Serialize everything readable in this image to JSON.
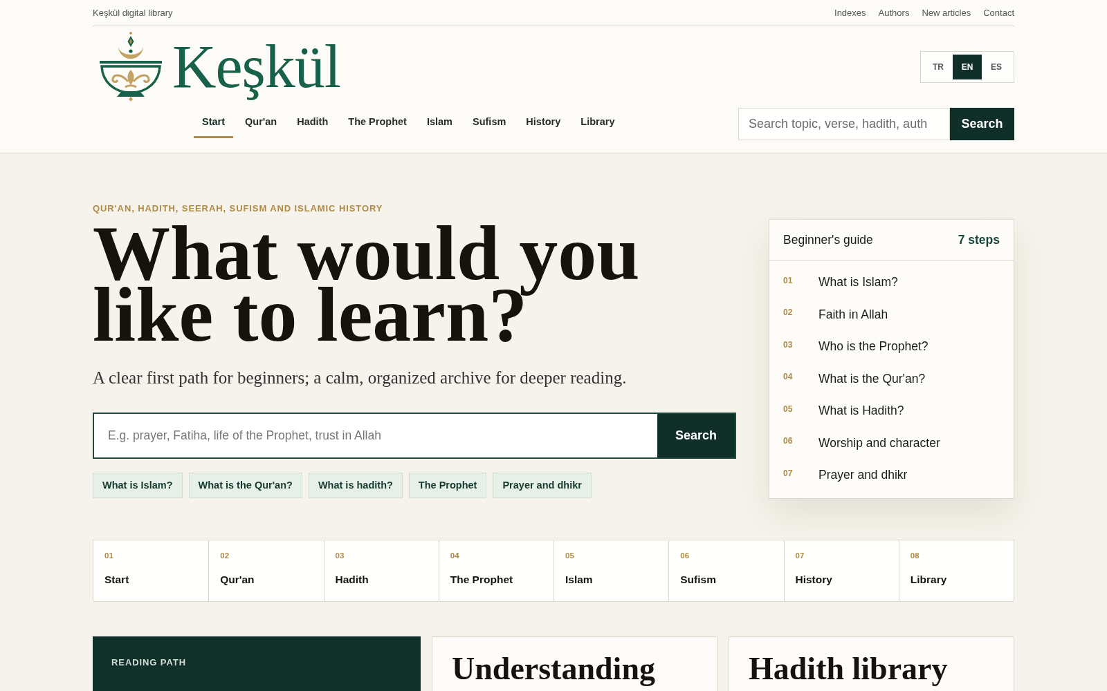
{
  "top_bar": {
    "site_name": "Keşkül digital library",
    "links": [
      "Indexes",
      "Authors",
      "New articles",
      "Contact"
    ]
  },
  "brand": {
    "name": "Keşkül"
  },
  "languages": [
    {
      "label": "TR",
      "selected": false
    },
    {
      "label": "EN",
      "selected": true
    },
    {
      "label": "ES",
      "selected": false
    }
  ],
  "nav": [
    {
      "label": "Start",
      "selected": true
    },
    {
      "label": "Qur'an",
      "selected": false
    },
    {
      "label": "Hadith",
      "selected": false
    },
    {
      "label": "The Prophet",
      "selected": false
    },
    {
      "label": "Islam",
      "selected": false
    },
    {
      "label": "Sufism",
      "selected": false
    },
    {
      "label": "History",
      "selected": false
    },
    {
      "label": "Library",
      "selected": false
    }
  ],
  "header_search": {
    "placeholder": "Search topic, verse, hadith, auth",
    "button": "Search"
  },
  "hero": {
    "eyebrow": "QUR'AN, HADITH, SEERAH, SUFISM AND ISLAMIC HISTORY",
    "title": "What would you like to learn?",
    "subtitle": "A clear first path for beginners; a calm, organized archive for deeper reading.",
    "search": {
      "placeholder": "E.g. prayer, Fatiha, life of the Prophet, trust in Allah",
      "button": "Search"
    },
    "chips": [
      "What is Islam?",
      "What is the Qur'an?",
      "What is hadith?",
      "The Prophet",
      "Prayer and dhikr"
    ]
  },
  "guide": {
    "title": "Beginner's guide",
    "count": "7 steps",
    "items": [
      {
        "number": "01",
        "label": "What is Islam?"
      },
      {
        "number": "02",
        "label": "Faith in Allah"
      },
      {
        "number": "03",
        "label": "Who is the Prophet?"
      },
      {
        "number": "04",
        "label": "What is the Qur'an?"
      },
      {
        "number": "05",
        "label": "What is Hadith?"
      },
      {
        "number": "06",
        "label": "Worship and character"
      },
      {
        "number": "07",
        "label": "Prayer and dhikr"
      }
    ]
  },
  "sections": [
    {
      "number": "01",
      "label": "Start"
    },
    {
      "number": "02",
      "label": "Qur'an"
    },
    {
      "number": "03",
      "label": "Hadith"
    },
    {
      "number": "04",
      "label": "The Prophet"
    },
    {
      "number": "05",
      "label": "Islam"
    },
    {
      "number": "06",
      "label": "Sufism"
    },
    {
      "number": "07",
      "label": "History"
    },
    {
      "number": "08",
      "label": "Library"
    }
  ],
  "cards": [
    {
      "kind": "featured",
      "eyebrow": "READING PATH"
    },
    {
      "kind": "plain",
      "title": "Understanding"
    },
    {
      "kind": "plain",
      "title": "Hadith library"
    }
  ]
}
